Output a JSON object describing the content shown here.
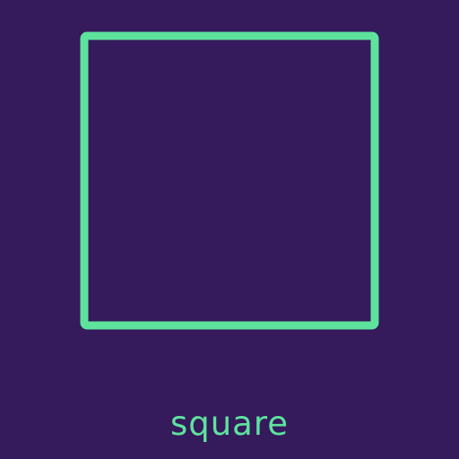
{
  "caption": "square",
  "shape": {
    "name": "square"
  },
  "colors": {
    "background": "#351a5c",
    "accent": "#5ee39d"
  }
}
